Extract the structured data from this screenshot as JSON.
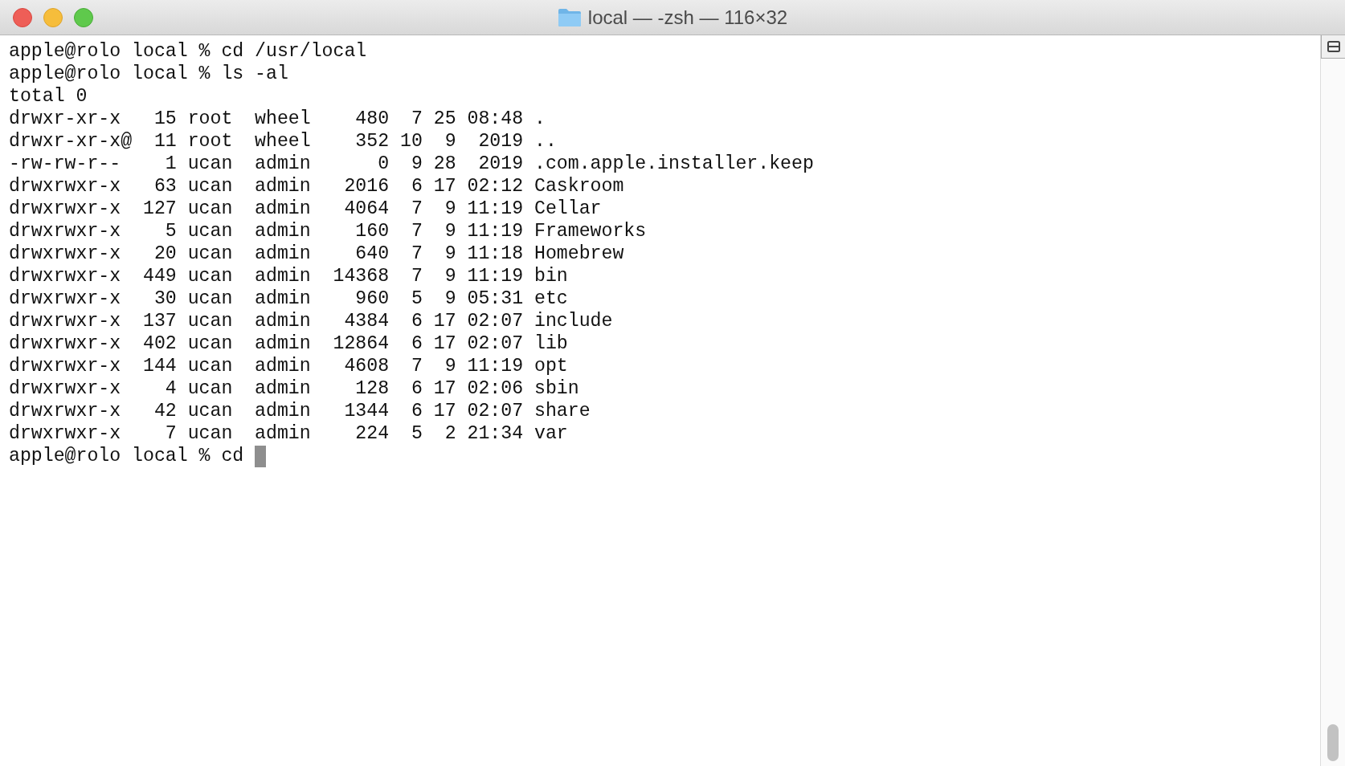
{
  "window": {
    "title": "local — -zsh — 116×32"
  },
  "terminal": {
    "lines": [
      "apple@rolo local % cd /usr/local",
      "apple@rolo local % ls -al",
      "total 0",
      "drwxr-xr-x   15 root  wheel    480  7 25 08:48 .",
      "drwxr-xr-x@  11 root  wheel    352 10  9  2019 ..",
      "-rw-rw-r--    1 ucan  admin      0  9 28  2019 .com.apple.installer.keep",
      "drwxrwxr-x   63 ucan  admin   2016  6 17 02:12 Caskroom",
      "drwxrwxr-x  127 ucan  admin   4064  7  9 11:19 Cellar",
      "drwxrwxr-x    5 ucan  admin    160  7  9 11:19 Frameworks",
      "drwxrwxr-x   20 ucan  admin    640  7  9 11:18 Homebrew",
      "drwxrwxr-x  449 ucan  admin  14368  7  9 11:19 bin",
      "drwxrwxr-x   30 ucan  admin    960  5  9 05:31 etc",
      "drwxrwxr-x  137 ucan  admin   4384  6 17 02:07 include",
      "drwxrwxr-x  402 ucan  admin  12864  6 17 02:07 lib",
      "drwxrwxr-x  144 ucan  admin   4608  7  9 11:19 opt",
      "drwxrwxr-x    4 ucan  admin    128  6 17 02:06 sbin",
      "drwxrwxr-x   42 ucan  admin   1344  6 17 02:07 share",
      "drwxrwxr-x    7 ucan  admin    224  5  2 21:34 var",
      "apple@rolo local % cd"
    ],
    "cursor": true
  }
}
